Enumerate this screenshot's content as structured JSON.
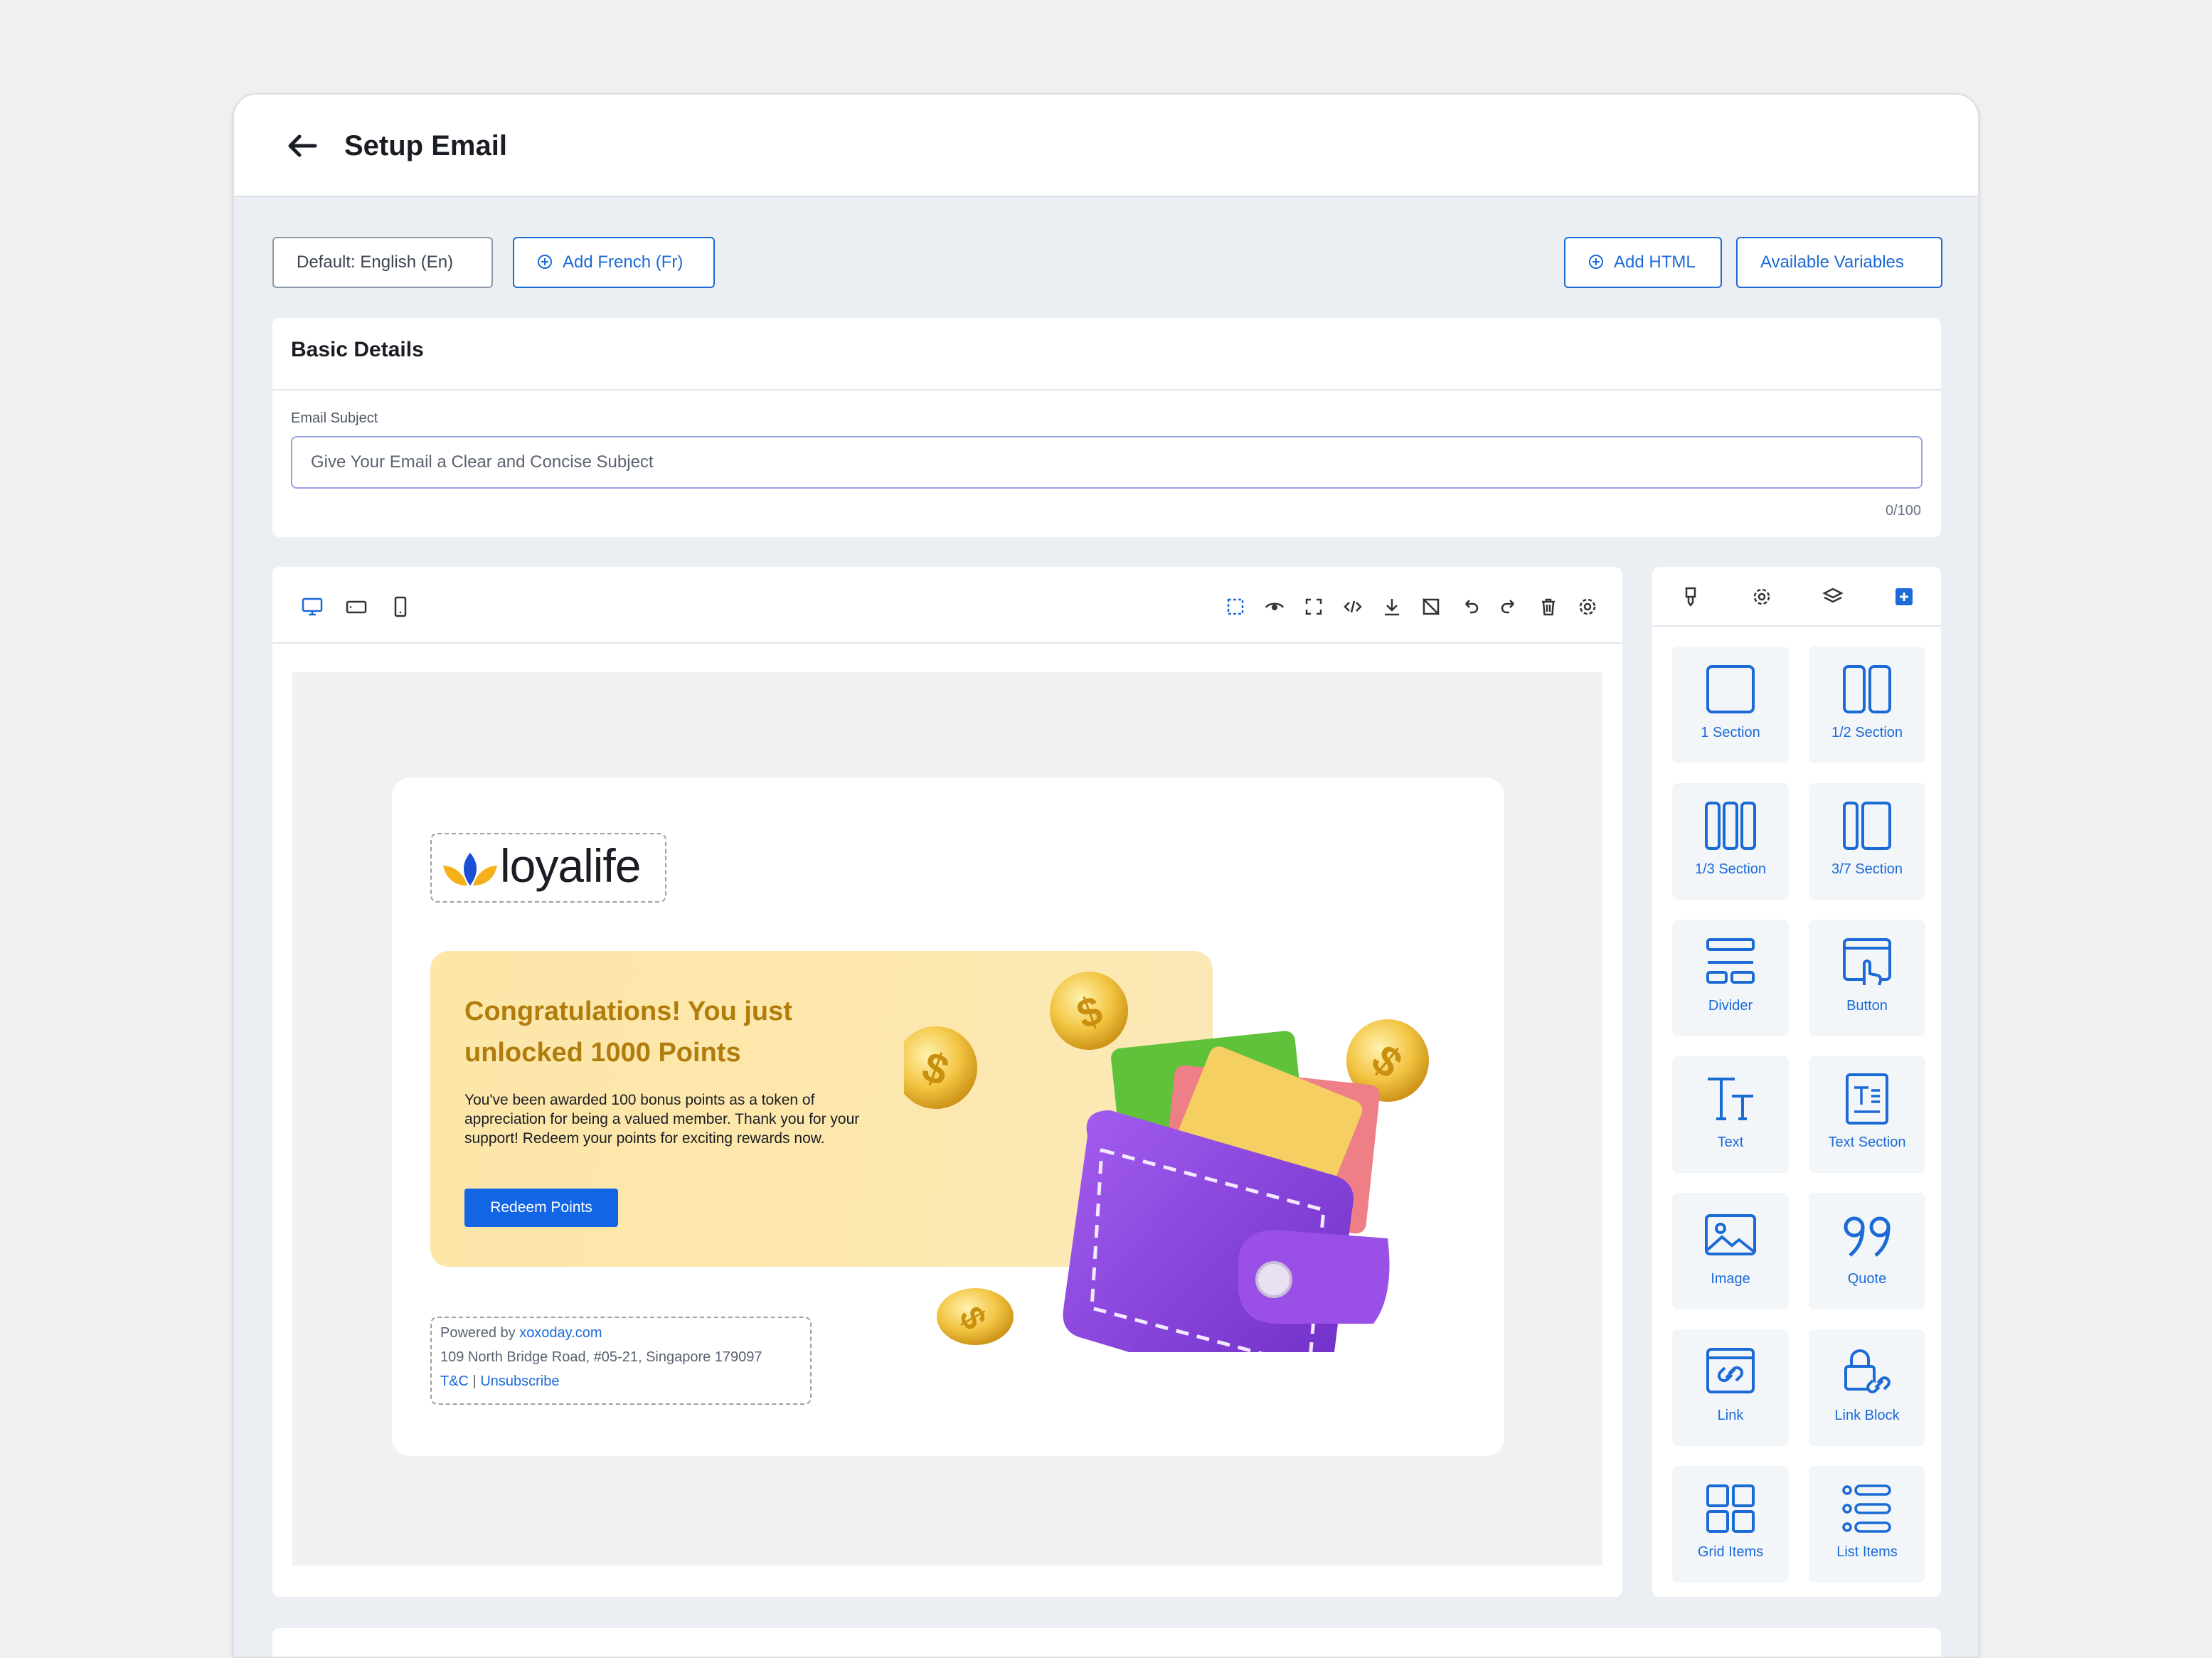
{
  "header": {
    "title": "Setup Email"
  },
  "languages": {
    "default_label": "Default: English (En)",
    "add_label": "Add French (Fr)"
  },
  "actions": {
    "add_html_label": "Add HTML",
    "variables_label": "Available Variables"
  },
  "basic_details": {
    "title": "Basic Details",
    "subject_label": "Email Subject",
    "subject_placeholder": "Give Your Email a Clear and Concise Subject",
    "subject_value": "",
    "char_count": "0/100"
  },
  "email_preview": {
    "logo_text": "loyalife",
    "headline": "Congratulations! You just unlocked 1000 Points",
    "body": "You've been awarded 100 bonus points as a token of appreciation for being a valued member. Thank you for your support! Redeem your points for exciting rewards now.",
    "cta_label": "Redeem Points",
    "footer": {
      "powered_prefix": "Powered by",
      "powered_link": "xoxoday.com",
      "address": "109 North Bridge Road, #05-21, Singapore 179097",
      "tc": "T&C",
      "separator": "|",
      "unsubscribe": "Unsubscribe"
    }
  },
  "blocks": [
    {
      "label": "1 Section",
      "icon": "one-section-icon"
    },
    {
      "label": "1/2 Section",
      "icon": "half-section-icon"
    },
    {
      "label": "1/3 Section",
      "icon": "third-section-icon"
    },
    {
      "label": "3/7 Section",
      "icon": "three-seven-section-icon"
    },
    {
      "label": "Divider",
      "icon": "divider-icon"
    },
    {
      "label": "Button",
      "icon": "button-icon"
    },
    {
      "label": "Text",
      "icon": "text-icon"
    },
    {
      "label": "Text Section",
      "icon": "text-section-icon"
    },
    {
      "label": "Image",
      "icon": "image-icon"
    },
    {
      "label": "Quote",
      "icon": "quote-icon"
    },
    {
      "label": "Link",
      "icon": "link-icon"
    },
    {
      "label": "Link Block",
      "icon": "link-block-icon"
    },
    {
      "label": "Grid Items",
      "icon": "grid-items-icon"
    },
    {
      "label": "List Items",
      "icon": "list-items-icon"
    }
  ],
  "colors": {
    "accent": "#1b6ad6",
    "cta": "#1266e6",
    "headline": "#b07d0d",
    "wallet": "#8b3fd9"
  }
}
